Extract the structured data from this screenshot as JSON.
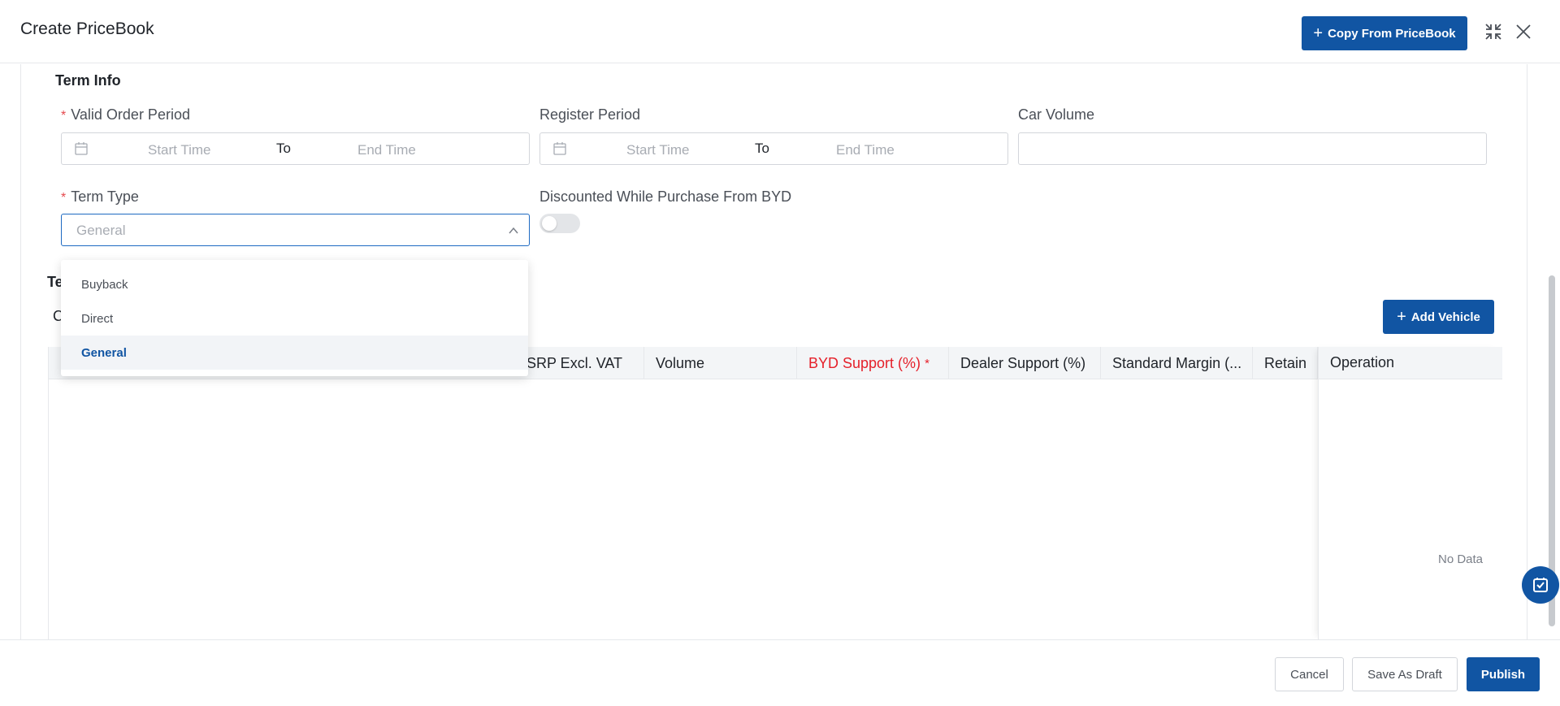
{
  "header": {
    "title": "Create PriceBook",
    "copy_button": "Copy From PriceBook"
  },
  "term_info": {
    "section_title": "Term Info",
    "valid_order_period": {
      "label": "Valid Order Period",
      "start_placeholder": "Start Time",
      "separator": "To",
      "end_placeholder": "End Time"
    },
    "register_period": {
      "label": "Register Period",
      "start_placeholder": "Start Time",
      "separator": "To",
      "end_placeholder": "End Time"
    },
    "car_volume": {
      "label": "Car Volume",
      "value": ""
    },
    "term_type": {
      "label": "Term Type",
      "selected": "General",
      "options": [
        "Buyback",
        "Direct",
        "General"
      ]
    },
    "discounted": {
      "label": "Discounted While Purchase From BYD",
      "enabled": false
    }
  },
  "vehicle_section": {
    "title_partial": "Te",
    "subtitle_partial": "C",
    "add_button": "Add Vehicle",
    "columns": [
      "SRP Excl. VAT",
      "Volume",
      "BYD Support (%)",
      "Dealer Support (%)",
      "Standard Margin (...",
      "Retain",
      "Operation"
    ],
    "required_column_mark": "*",
    "empty_text": "No Data"
  },
  "footer": {
    "cancel": "Cancel",
    "save_draft": "Save As Draft",
    "publish": "Publish"
  },
  "colors": {
    "primary": "#1155a3",
    "required": "#e5202a"
  }
}
